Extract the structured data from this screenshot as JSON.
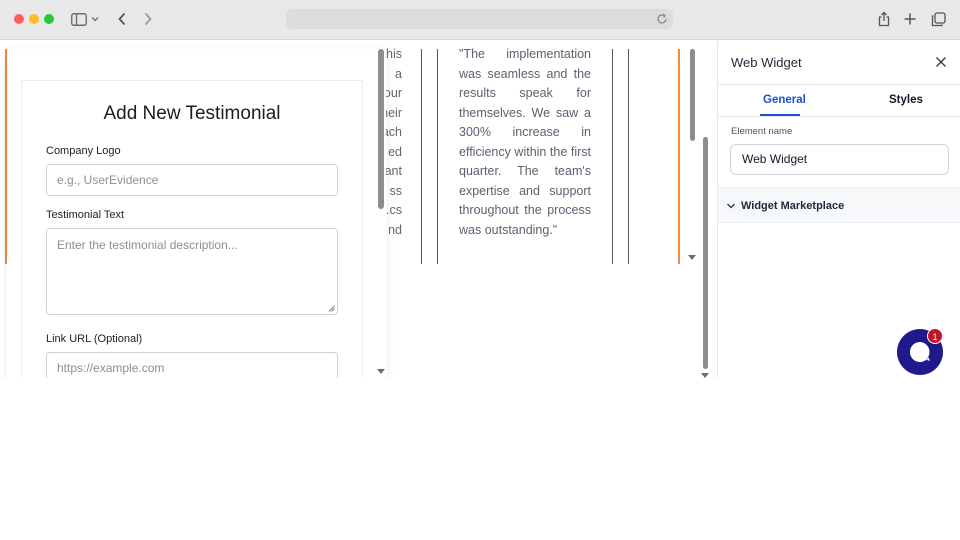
{
  "form": {
    "title": "Add New Testimonial",
    "company_logo_label": "Company Logo",
    "company_logo_placeholder": "e.g., UserEvidence",
    "testimonial_text_label": "Testimonial Text",
    "testimonial_text_placeholder": "Enter the testimonial description...",
    "link_url_label": "Link URL (Optional)",
    "link_url_placeholder": "https://example.com"
  },
  "clipped_column": [
    "his",
    "a",
    "our",
    "heir",
    "ach",
    "ed",
    "ant",
    "ss",
    "cs.",
    "nd"
  ],
  "quote": "\"The implementation was seamless and the results speak for themselves. We saw a 300% increase in efficiency within the first quarter. The team's expertise and support throughout the process was outstanding.\"",
  "panel": {
    "title": "Web Widget",
    "tabs": {
      "general": "General",
      "styles": "Styles"
    },
    "element_name_label": "Element name",
    "element_name_value": "Web Widget",
    "section_label": "Widget Marketplace"
  },
  "chat": {
    "badge_count": "1"
  },
  "colors": {
    "accent_orange": "#f58a3a",
    "tab_active": "#1d4ed8",
    "chat_bg": "#1e1a8c",
    "badge": "#c0142a"
  }
}
